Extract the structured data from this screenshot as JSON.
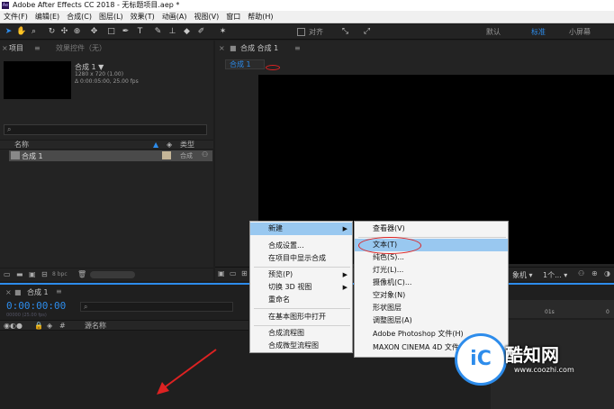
{
  "app": {
    "title": "Adobe After Effects CC 2018 - 无标题项目.aep *",
    "logo": "Ae"
  },
  "menubar": [
    "文件(F)",
    "编辑(E)",
    "合成(C)",
    "图层(L)",
    "效果(T)",
    "动画(A)",
    "视图(V)",
    "窗口",
    "帮助(H)"
  ],
  "toolbar": {
    "align_label": "对齐",
    "workspaces": [
      "默认",
      "标准",
      "小屏幕"
    ],
    "active_workspace": "标准",
    "tool_icons": [
      "selection-arrow-icon",
      "hand-icon",
      "zoom-icon",
      "rotate-icon",
      "camera-orbit-icon",
      "pan-behind-icon",
      "rectangle-icon",
      "pen-icon",
      "type-icon",
      "brush-icon",
      "clone-stamp-icon",
      "eraser-icon",
      "roto-brush-icon",
      "puppet-pin-icon"
    ]
  },
  "project_panel": {
    "tab_project": "项目",
    "tab_effects": "效果控件（无）",
    "comp_name": "合成 1 ▼",
    "comp_size": "1280 x 720 (1.00)",
    "comp_duration": "Δ 0:00:05:00, 25.00 fps",
    "search_icon": "search-icon",
    "col_name": "名称",
    "col_type": "类型",
    "items": [
      {
        "name": "合成 1",
        "type": "合成"
      }
    ],
    "bpc": "8 bpc"
  },
  "composition_panel": {
    "header": "合成 合成 1",
    "tab": "合成 1"
  },
  "timeline": {
    "tab": "合成 1",
    "timecode": "0:00:00:00",
    "timecode_sub": "00000 (25.00 fps)",
    "col_source": "源名称",
    "ruler_marks": [
      "01s",
      "0"
    ]
  },
  "context_menu": {
    "items": [
      {
        "label": "新建",
        "submenu": true,
        "highlighted": true
      },
      {
        "label": "合成设置..."
      },
      {
        "label": "在项目中显示合成"
      },
      {
        "label": "预览(P)",
        "submenu": true
      },
      {
        "label": "切换 3D 视图",
        "submenu": true
      },
      {
        "label": "重命名"
      },
      {
        "label": "在基本图形中打开"
      },
      {
        "label": "合成流程图"
      },
      {
        "label": "合成微型流程图"
      }
    ]
  },
  "submenu": {
    "items": [
      {
        "label": "查看器(V)"
      },
      {
        "label": "文本(T)",
        "highlighted": true
      },
      {
        "label": "纯色(S)..."
      },
      {
        "label": "灯光(L)..."
      },
      {
        "label": "摄像机(C)..."
      },
      {
        "label": "空对象(N)"
      },
      {
        "label": "形状图层"
      },
      {
        "label": "调整图层(A)"
      },
      {
        "label": "Adobe Photoshop 文件(H)"
      },
      {
        "label": "MAXON CINEMA 4D 文件"
      }
    ]
  },
  "watermark": {
    "title": "酷知网",
    "url": "www.coozhi.com"
  },
  "colors": {
    "accent": "#2d8ceb",
    "highlight": "#99c8f0",
    "annotation": "#dd2222"
  }
}
